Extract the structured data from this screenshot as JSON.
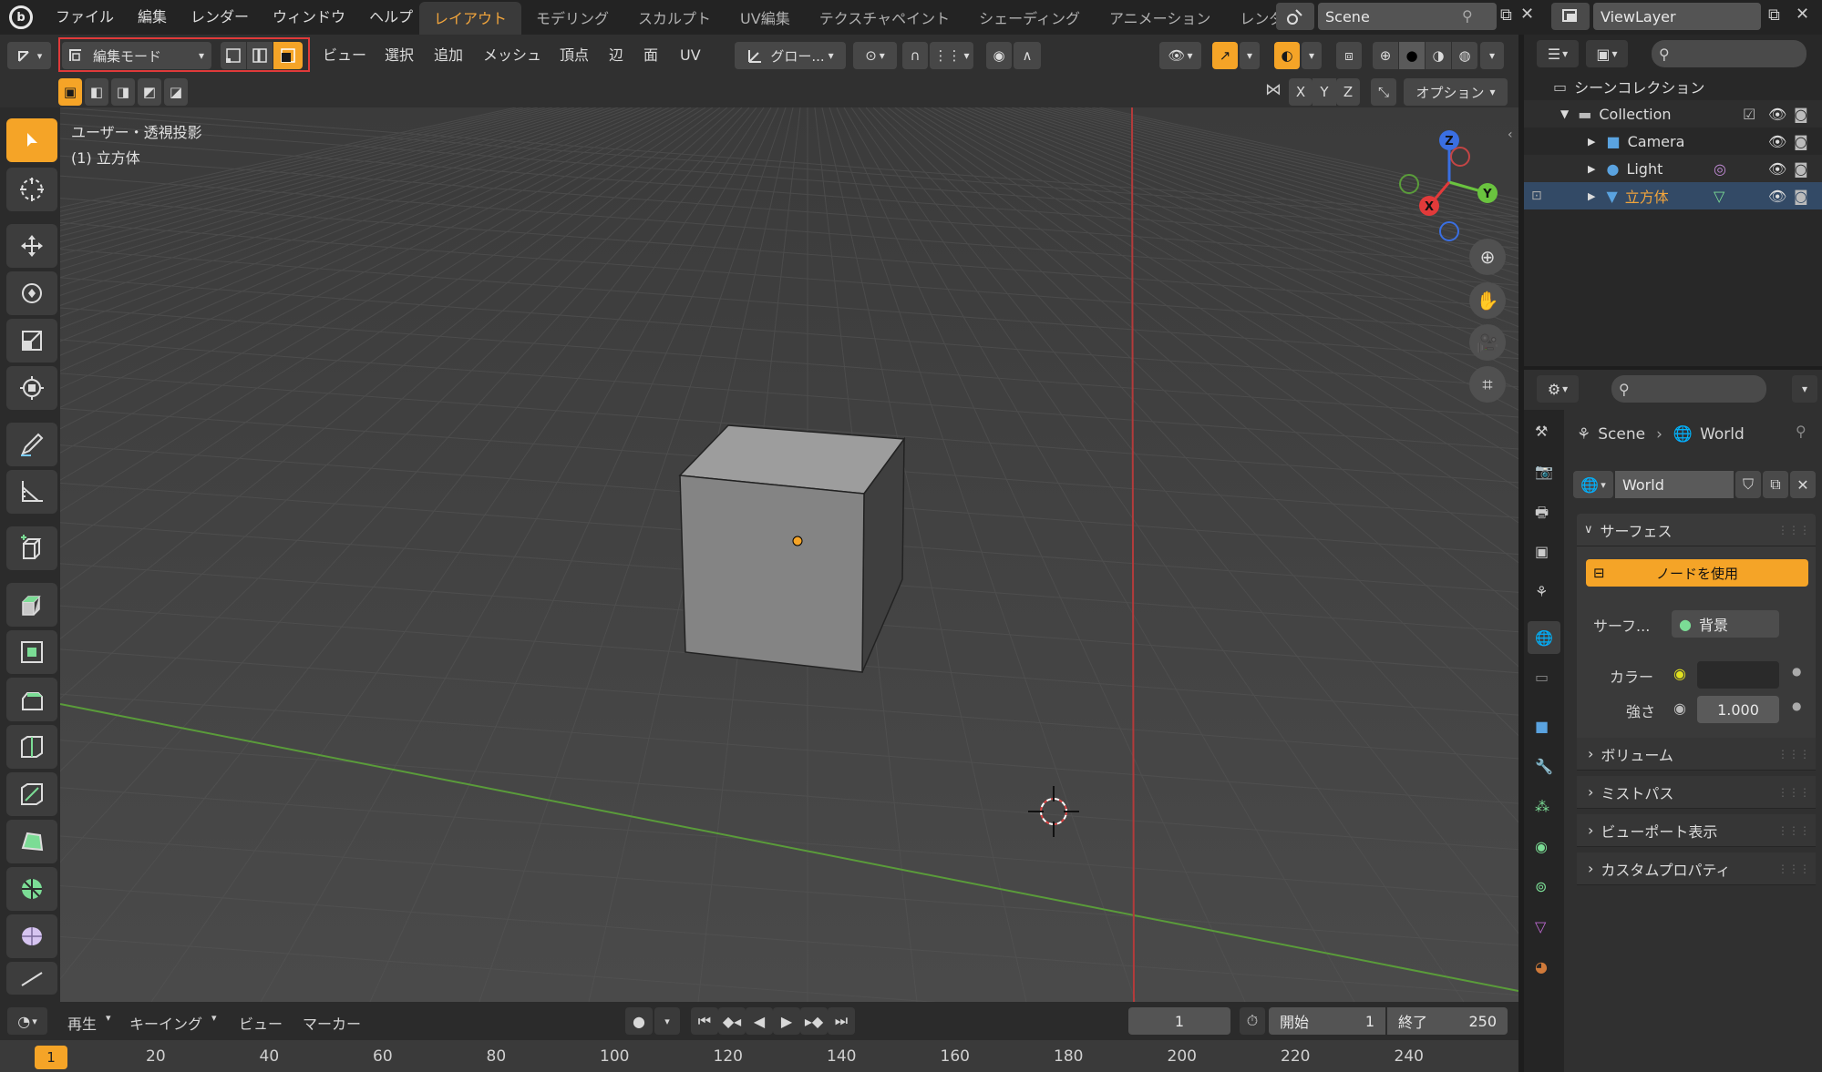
{
  "topbar": {
    "menus": [
      "ファイル",
      "編集",
      "レンダー",
      "ウィンドウ",
      "ヘルプ"
    ],
    "workspaces": [
      "レイアウト",
      "モデリング",
      "スカルプト",
      "UV編集",
      "テクスチャペイント",
      "シェーディング",
      "アニメーション",
      "レンダリ"
    ],
    "active_workspace": "レイアウト",
    "scene_name": "Scene",
    "viewlayer_name": "ViewLayer"
  },
  "viewport_header": {
    "mode": "編集モード",
    "menus": [
      "ビュー",
      "選択",
      "追加",
      "メッシュ",
      "頂点",
      "辺",
      "面",
      "UV"
    ],
    "transform_orientation": "グロー...",
    "options": "オプション",
    "axis_x": "X",
    "axis_y": "Y",
    "axis_z": "Z"
  },
  "viewport": {
    "view_label": "ユーザー・透視投影",
    "object_label": "(1) 立方体",
    "gizmo": {
      "x": "X",
      "y": "Y",
      "z": "Z"
    }
  },
  "outliner": {
    "root": "シーンコレクション",
    "collection": "Collection",
    "items": [
      {
        "name": "Camera",
        "color": "#5aa3e0"
      },
      {
        "name": "Light",
        "color": "#5aa3e0"
      },
      {
        "name": "立方体",
        "color": "#f0a43c"
      }
    ]
  },
  "properties": {
    "breadcrumb_scene": "Scene",
    "breadcrumb_world": "World",
    "world_name": "World",
    "section_surface": "サーフェス",
    "use_nodes": "ノードを使用",
    "surface_label": "サーフ...",
    "surface_value": "背景",
    "color_label": "カラー",
    "strength_label": "強さ",
    "strength_value": "1.000",
    "sections": [
      "ボリューム",
      "ミストパス",
      "ビューポート表示",
      "カスタムプロパティ"
    ]
  },
  "timeline": {
    "menus": [
      "再生",
      "キーイング",
      "ビュー",
      "マーカー"
    ],
    "current_frame": "1",
    "start_label": "開始",
    "start_value": "1",
    "end_label": "終了",
    "end_value": "250",
    "ruler_ticks": [
      "20",
      "40",
      "60",
      "80",
      "100",
      "120",
      "140",
      "160",
      "180",
      "200",
      "220",
      "240"
    ],
    "ruler_current": "1"
  },
  "colors": {
    "accent": "#f5a427",
    "x_axis": "#e23a3a",
    "y_axis": "#6ac33f",
    "z_axis": "#3a6fe2",
    "highlight_box": "#e03a3a"
  }
}
